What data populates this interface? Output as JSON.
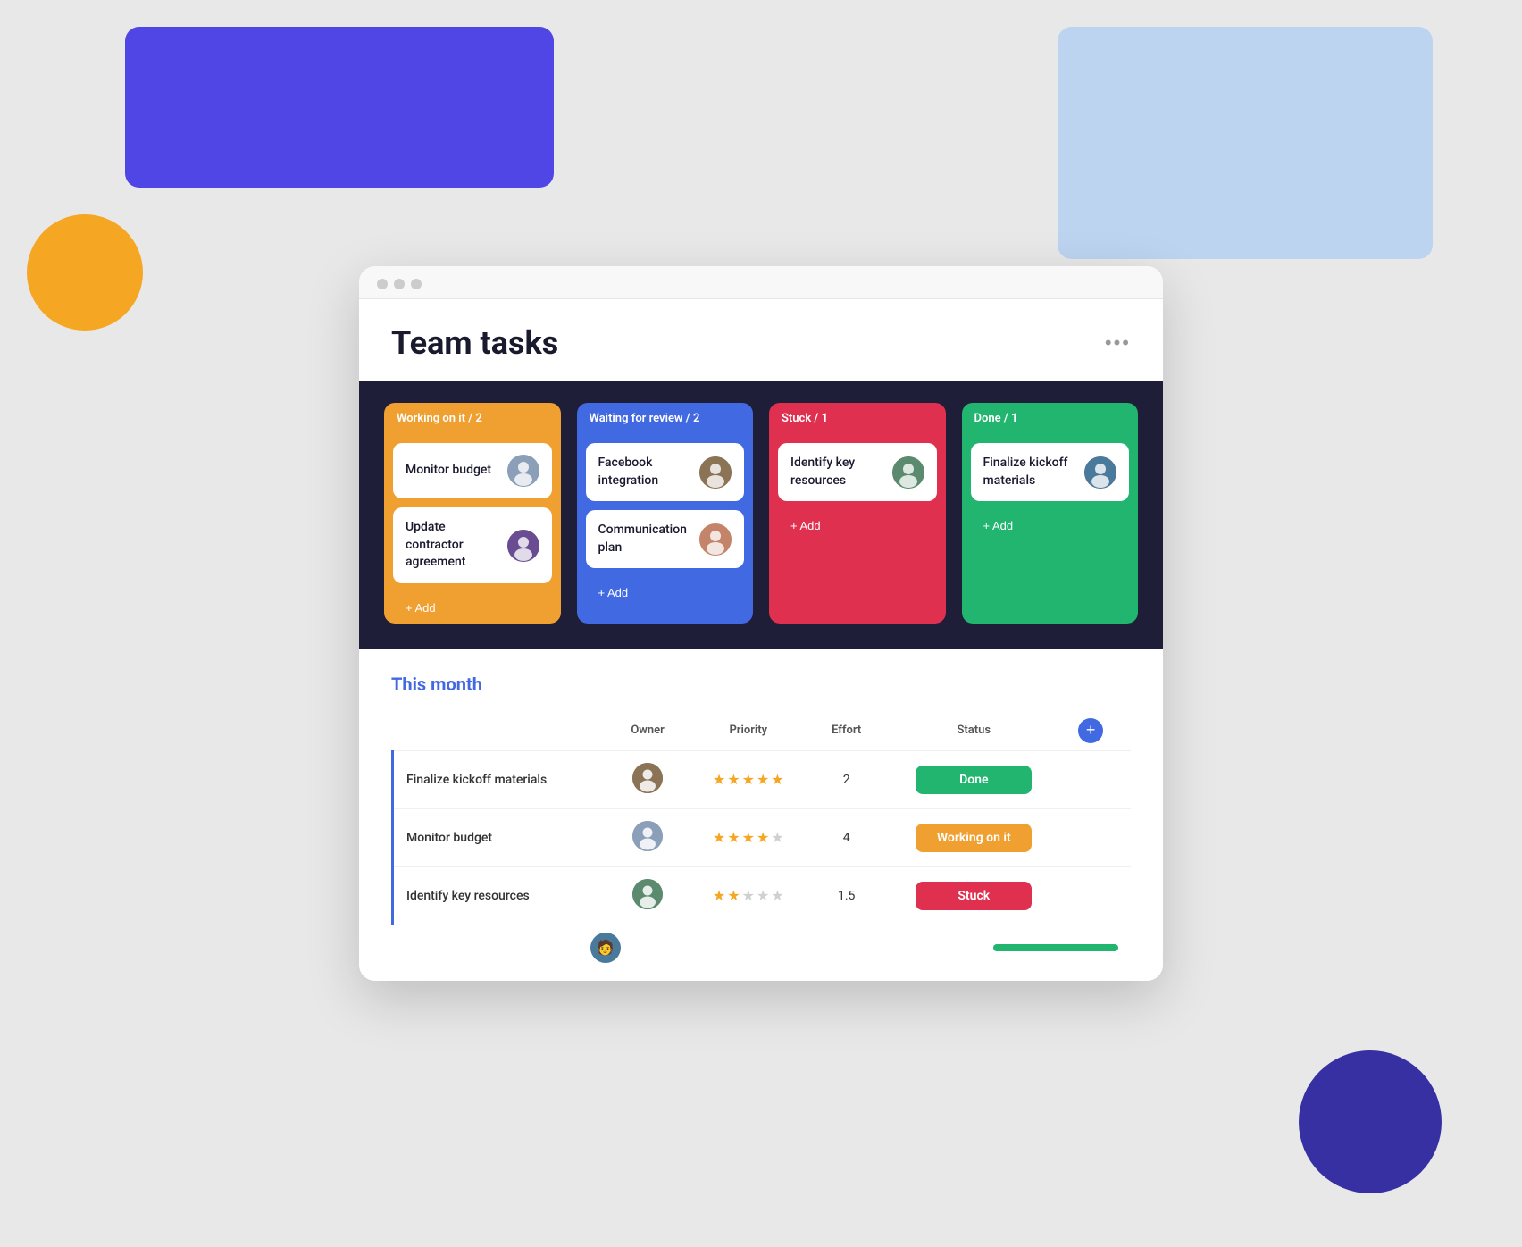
{
  "background": {
    "yellow_circle_color": "#f5a623",
    "purple_rect_color": "#4f46e5",
    "blue_rect_color": "#bcd4f0",
    "dark_blue_circle_color": "#3730a3"
  },
  "window": {
    "title": "Team tasks",
    "more_button_label": "•••"
  },
  "kanban": {
    "columns": [
      {
        "id": "working",
        "header": "Working on it / 2",
        "color_class": "col-orange",
        "tasks": [
          {
            "name": "Monitor budget",
            "avatar_class": "avatar-1",
            "avatar_glyph": "👤"
          },
          {
            "name": "Update contractor agreement",
            "avatar_class": "avatar-2",
            "avatar_glyph": "👤"
          }
        ],
        "add_label": "+ Add"
      },
      {
        "id": "waiting",
        "header": "Waiting for review / 2",
        "color_class": "col-blue",
        "tasks": [
          {
            "name": "Facebook integration",
            "avatar_class": "avatar-3",
            "avatar_glyph": "👤"
          },
          {
            "name": "Communication plan",
            "avatar_class": "avatar-4",
            "avatar_glyph": "👤"
          }
        ],
        "add_label": "+ Add"
      },
      {
        "id": "stuck",
        "header": "Stuck / 1",
        "color_class": "col-red",
        "tasks": [
          {
            "name": "Identify key resources",
            "avatar_class": "avatar-5",
            "avatar_glyph": "👤"
          }
        ],
        "add_label": "+ Add"
      },
      {
        "id": "done",
        "header": "Done / 1",
        "color_class": "col-green",
        "tasks": [
          {
            "name": "Finalize kickoff materials",
            "avatar_class": "avatar-6",
            "avatar_glyph": "👤"
          }
        ],
        "add_label": "+ Add"
      }
    ]
  },
  "table": {
    "section_title": "This month",
    "columns": [
      "Owner",
      "Priority",
      "Effort",
      "Status"
    ],
    "rows": [
      {
        "name": "Finalize kickoff materials",
        "owner_avatar_class": "avatar-3",
        "stars_filled": 5,
        "stars_total": 5,
        "effort": "2",
        "status": "Done",
        "status_class": "badge-done"
      },
      {
        "name": "Monitor budget",
        "owner_avatar_class": "avatar-1",
        "stars_filled": 4,
        "stars_total": 5,
        "effort": "4",
        "status": "Working on it",
        "status_class": "badge-working"
      },
      {
        "name": "Identify key resources",
        "owner_avatar_class": "avatar-5",
        "stars_filled": 2,
        "stars_total": 5,
        "effort": "1.5",
        "status": "Stuck",
        "status_class": "badge-stuck"
      }
    ],
    "partial_row_avatar_class": "avatar-7"
  }
}
